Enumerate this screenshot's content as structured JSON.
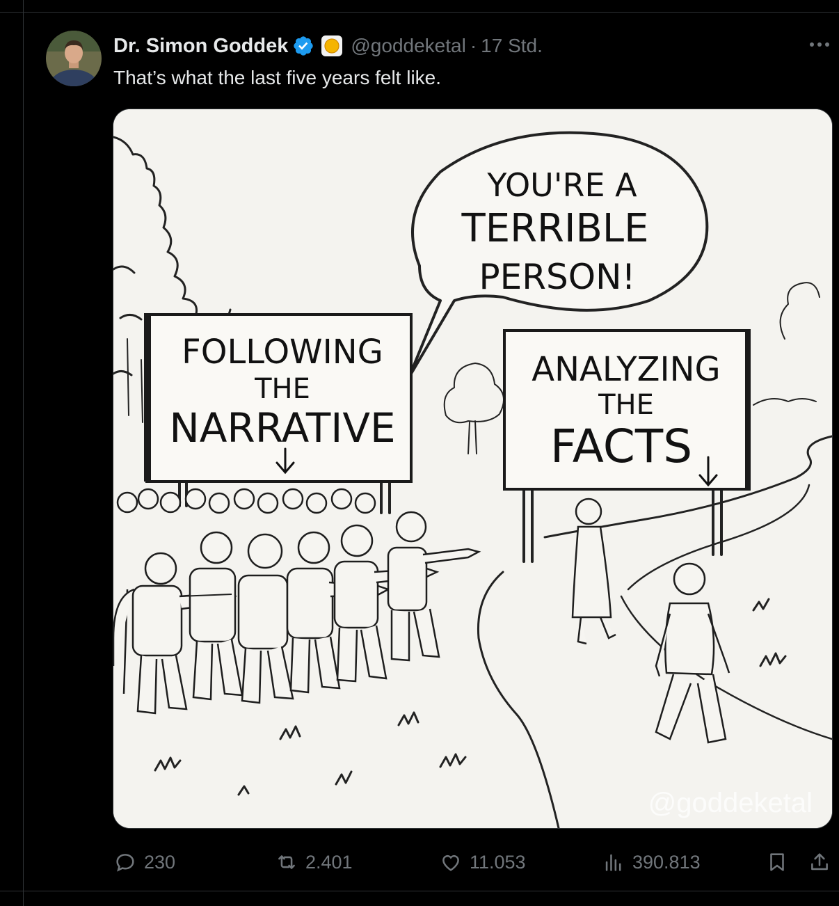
{
  "tweet": {
    "author_name": "Dr. Simon Goddek",
    "handle": "@goddeketal",
    "separator": "·",
    "time": "17 Std.",
    "text": "That’s what the last five years felt like."
  },
  "image": {
    "speech_bubble": [
      "YOU'RE A",
      "TERRIBLE",
      "PERSON!"
    ],
    "left_sign": [
      "FOLLOWING",
      "THE",
      "NARRATIVE"
    ],
    "right_sign": [
      "ANALYZING",
      "THE",
      "FACTS"
    ],
    "watermark": "@goddeketal"
  },
  "actions": {
    "replies": "230",
    "reposts": "2.401",
    "likes": "11.053",
    "views": "390.813"
  },
  "icons": {
    "verified": "verified-badge-icon",
    "affiliation": "affiliation-badge-icon",
    "more": "more-options-icon",
    "reply": "reply-icon",
    "repost": "repost-icon",
    "like": "like-icon",
    "views": "views-icon",
    "bookmark": "bookmark-icon",
    "share": "share-icon"
  },
  "colors": {
    "verified": "#1d9bf0",
    "muted": "#71767b",
    "text": "#e7e9ea",
    "background": "#000000"
  }
}
